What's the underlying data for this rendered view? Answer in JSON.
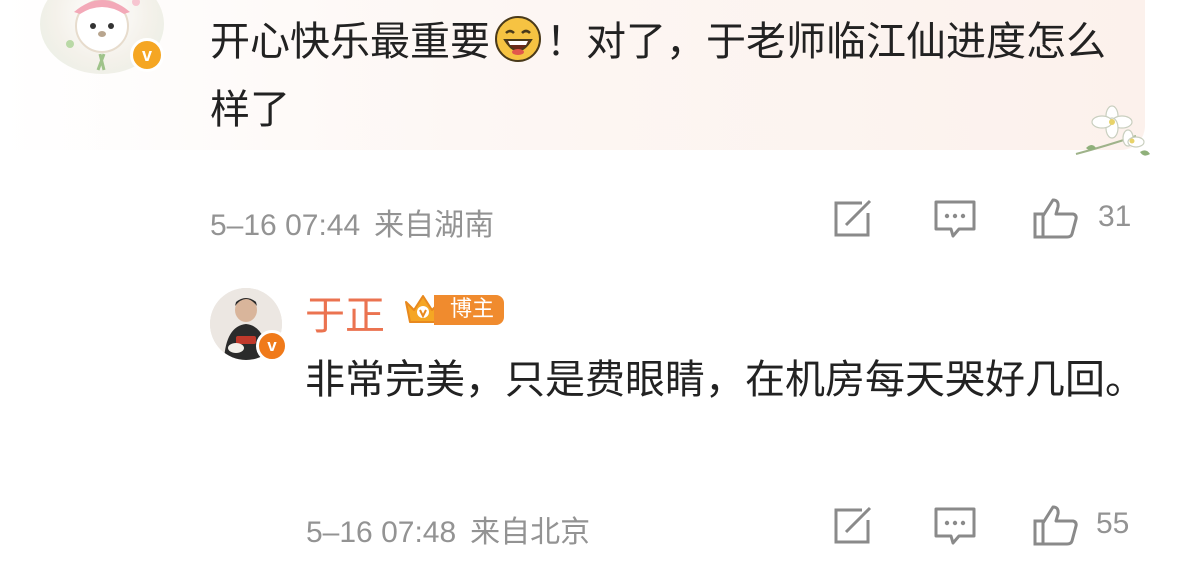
{
  "comments": [
    {
      "text_before_emoji": "开心快乐最重要",
      "emoji": "laughing-face-emoji",
      "text_after_emoji": "！对了，于老师临江仙进度怎么样了",
      "time": "5–16 07:44",
      "location": "来自湖南",
      "likes": "31",
      "verified": true
    },
    {
      "username": "于正",
      "badge_label": "博主",
      "text": "非常完美，只是费眼睛，在机房每天哭好几回。",
      "time": "5–16 07:48",
      "location": "来自北京",
      "likes": "55",
      "verified": true
    }
  ],
  "icons": {
    "share": "share-edit-icon",
    "reply": "comment-icon",
    "like": "thumbs-up-icon"
  },
  "colors": {
    "username": "#eb7350",
    "meta": "#939393",
    "verified_badge": "#f5a623",
    "owner_badge": "#f08b2e"
  }
}
